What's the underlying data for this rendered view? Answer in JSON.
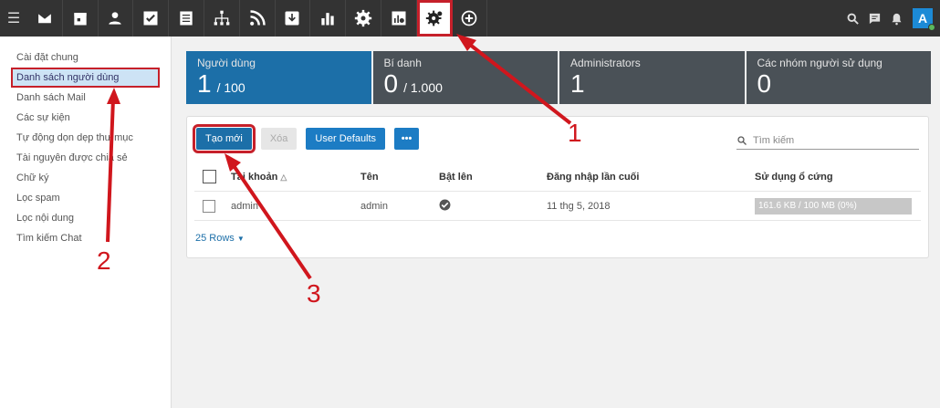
{
  "topbar": {
    "apps": [
      {
        "icon": "mail-icon"
      },
      {
        "icon": "calendar-icon"
      },
      {
        "icon": "contacts-icon"
      },
      {
        "icon": "tasks-icon"
      },
      {
        "icon": "notes-icon"
      },
      {
        "icon": "org-chart-icon"
      },
      {
        "icon": "rss-icon"
      },
      {
        "icon": "archive-icon"
      },
      {
        "icon": "reports-icon"
      },
      {
        "icon": "settings-icon"
      },
      {
        "icon": "domain-stats-icon"
      },
      {
        "icon": "admin-settings-icon",
        "active": true
      },
      {
        "icon": "add-icon"
      }
    ],
    "avatar_letter": "A"
  },
  "sidebar": {
    "items": [
      {
        "label": "Cài đặt chung"
      },
      {
        "label": "Danh sách người dùng",
        "active": true
      },
      {
        "label": "Danh sách Mail"
      },
      {
        "label": "Các sự kiện"
      },
      {
        "label": "Tự động dọn dẹp thư mục"
      },
      {
        "label": "Tài nguyên được chia sẻ"
      },
      {
        "label": "Chữ ký"
      },
      {
        "label": "Lọc spam"
      },
      {
        "label": "Lọc nội dung"
      },
      {
        "label": "Tìm kiếm Chat"
      }
    ]
  },
  "stats": [
    {
      "label": "Người dùng",
      "value": "1",
      "sub": "/ 100"
    },
    {
      "label": "Bí danh",
      "value": "0",
      "sub": "/ 1.000"
    },
    {
      "label": "Administrators",
      "value": "1",
      "sub": ""
    },
    {
      "label": "Các nhóm người sử dụng",
      "value": "0",
      "sub": ""
    }
  ],
  "toolbar": {
    "create_label": "Tạo mới",
    "delete_label": "Xóa",
    "user_defaults_label": "User Defaults",
    "more_label": "•••",
    "search_placeholder": "Tìm kiếm"
  },
  "table": {
    "headers": [
      "Tài khoản",
      "Tên",
      "Bật lên",
      "Đăng nhập lần cuối",
      "Sử dụng ổ cứng"
    ],
    "rows": [
      {
        "account": "admin",
        "name": "admin",
        "enabled": true,
        "last_login": "11 thg 5, 2018",
        "usage": "161.6 KB / 100 MB (0%)"
      }
    ],
    "rows_per_page": "25 Rows"
  },
  "annotations": [
    "1",
    "2",
    "3"
  ],
  "colors": {
    "accent": "#1c6fa8",
    "annotation": "#d0161d"
  }
}
